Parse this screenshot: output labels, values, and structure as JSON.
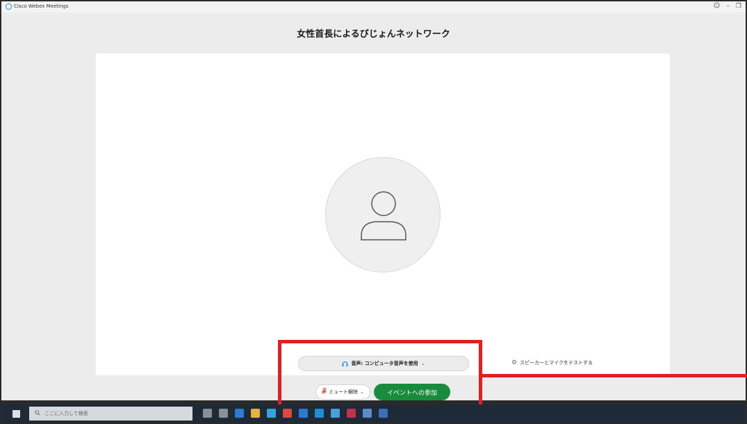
{
  "window": {
    "app_title": "Cisco Webex Meetings",
    "help_icon": "help-icon",
    "minimize_glyph": "–",
    "restore_glyph": "❐"
  },
  "meeting": {
    "title": "女性首長によるびじょんネットワーク"
  },
  "audio": {
    "label": "音声: コンピュータ音声を使用",
    "chevron": "⌄",
    "icon": "headset-icon"
  },
  "test": {
    "label": "スピーカーとマイクをテストする",
    "icon": "gear-icon"
  },
  "mute": {
    "label": "ミュート解除",
    "chevron": "⌄",
    "icon": "mic-muted-icon"
  },
  "join": {
    "label": "イベントへの参加"
  },
  "taskbar": {
    "search_placeholder": "ここに入力して検索"
  },
  "colors": {
    "join_button": "#1a8a3c",
    "annotation_red": "#e02020",
    "webex_blue": "#1f8ed6"
  }
}
